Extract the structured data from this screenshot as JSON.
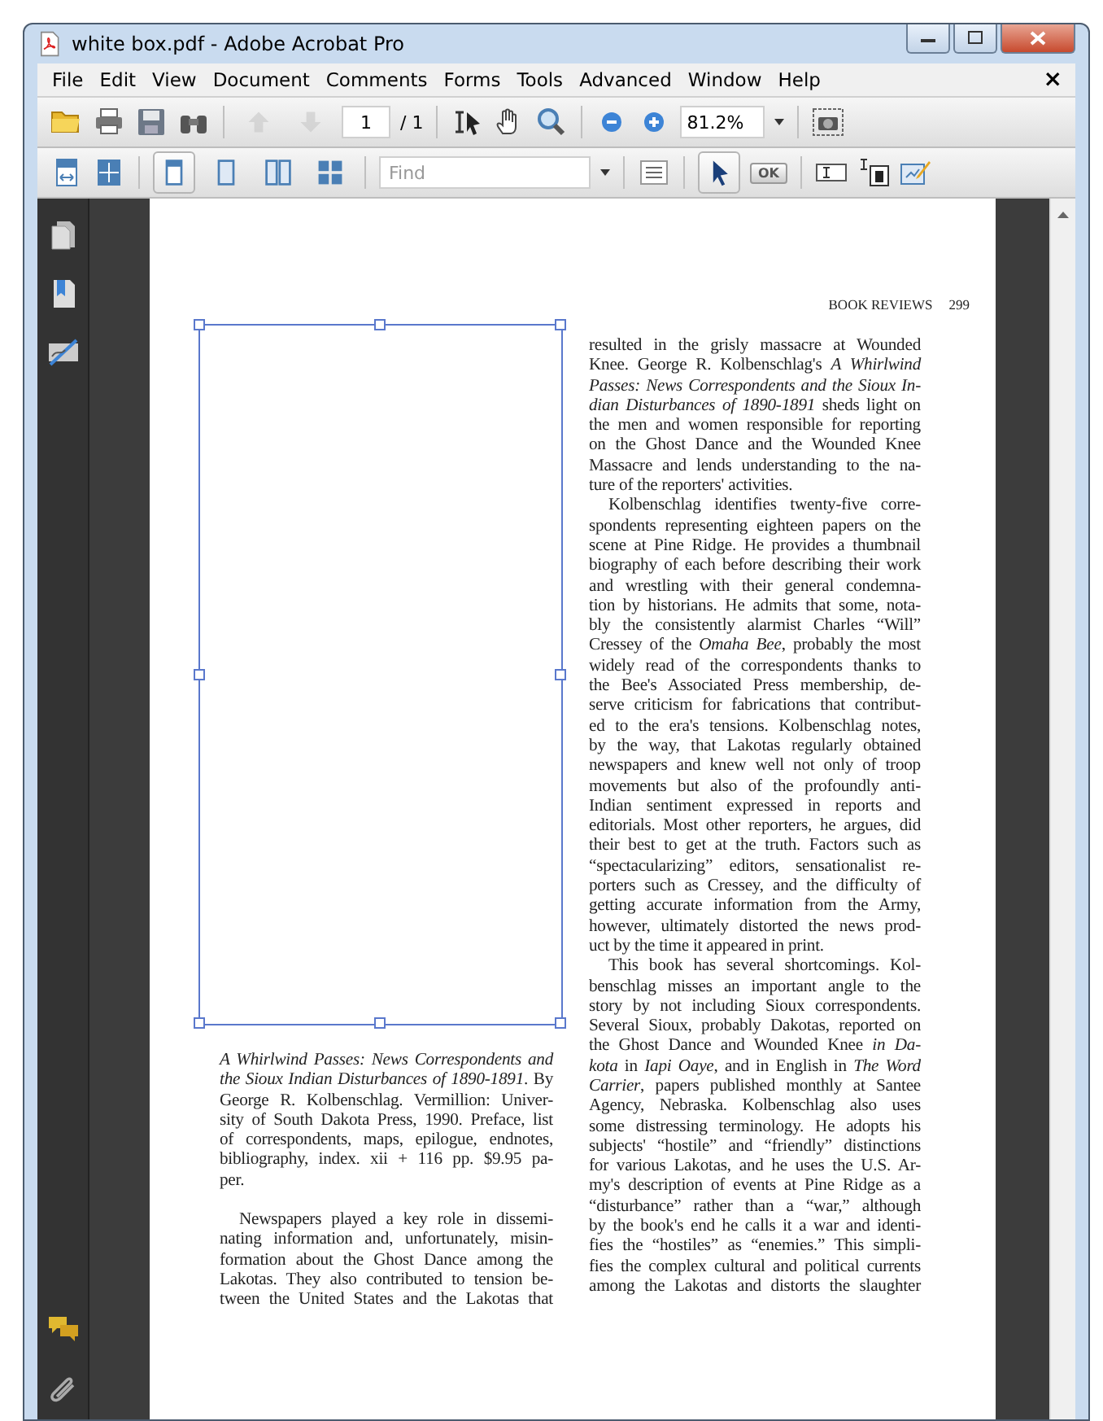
{
  "window": {
    "title": "white box.pdf - Adobe Acrobat Pro"
  },
  "menu": [
    "File",
    "Edit",
    "View",
    "Document",
    "Comments",
    "Forms",
    "Tools",
    "Advanced",
    "Window",
    "Help"
  ],
  "menu_close": "×",
  "toolbar": {
    "page_nav": [
      {
        "disabled": true
      },
      {
        "disabled": true
      }
    ],
    "page_field": {
      "value": "1"
    },
    "page_total": "/ 1",
    "zoom_field": {
      "value": "81.2%"
    }
  },
  "toolbar2": {
    "page_layouts": [
      {
        "selected": true
      },
      {
        "selected": false
      },
      {
        "selected": false
      },
      {
        "selected": false
      }
    ],
    "find": {
      "placeholder": "Find"
    },
    "select_tool": {
      "selected": true
    },
    "form_button": {
      "label": "OK"
    }
  },
  "page": {
    "running_head": "BOOK REVIEWS",
    "page_number": "299",
    "caption": [
      "*A Whirlwind Passes: News Correspondents and*",
      "*the Sioux Indian Disturbances of 1890-1891*. By",
      "George R. Kolbenschlag. Vermillion: Univer-",
      "sity of South Dakota Press, 1990. Preface, list",
      "of correspondents, maps, epilogue, endnotes,",
      "bibliography, index. xii + 116 pp. $9.95 pa-",
      "per."
    ],
    "left_paragraphs": [
      {
        "indent": true,
        "continued": true,
        "lines": [
          "Newspapers played a key role in dissemi-",
          "nating information and, unfortunately, misin-",
          "formation about the Ghost Dance among the",
          "Lakotas. They also contributed to tension be-",
          "tween the United States and the Lakotas that"
        ]
      }
    ],
    "right_paragraphs": [
      {
        "indent": false,
        "continued": false,
        "lines": [
          "resulted in the grisly massacre at Wounded",
          "Knee. George R. Kolbenschlag's *A Whirlwind*",
          "*Passes: News Correspondents and the Sioux In-*",
          "*dian Disturbances of 1890-1891* sheds light on",
          "the men and women responsible for reporting",
          "on the Ghost Dance and the Wounded Knee",
          "Massacre and lends understanding to the na-",
          "ture of the reporters' activities."
        ]
      },
      {
        "indent": true,
        "continued": false,
        "lines": [
          "Kolbenschlag identifies twenty-five corre-",
          "spondents representing eighteen papers on the",
          "scene at Pine Ridge. He provides a thumbnail",
          "biography of each before describing their work",
          "and wrestling with their general condemna-",
          "tion by historians. He admits that some, nota-",
          "bly the consistently alarmist Charles “Will”",
          "Cressey of the *Omaha Bee*, probably the most",
          "widely read of the correspondents thanks to",
          "the Bee's Associated Press membership, de-",
          "serve criticism for fabrications that contribut-",
          "ed to the era's tensions. Kolbenschlag notes,",
          "by the way, that Lakotas regularly obtained",
          "newspapers and knew well not only of troop",
          "movements but also of the profoundly anti-",
          "Indian sentiment expressed in reports and",
          "editorials. Most other reporters, he argues, did",
          "their best to get at the truth. Factors such as",
          "“spectacularizing” editors, sensationalist re-",
          "porters such as Cressey, and the difficulty of",
          "getting accurate information from the Army,",
          "however, ultimately distorted the news prod-",
          "uct by the time it appeared in print."
        ]
      },
      {
        "indent": true,
        "continued": true,
        "lines": [
          "This book has several shortcomings. Kol-",
          "benschlag misses an important angle to the",
          "story by not including Sioux correspondents.",
          "Several Sioux, probably Dakotas, reported on",
          "the Ghost Dance and Wounded Knee *in Da-*",
          "*kota* in *Iapi Oaye*, and in English in *The Word*",
          "*Carrier*, papers published monthly at Santee",
          "Agency, Nebraska. Kolbenschlag also uses",
          "some distressing terminology. He adopts his",
          "subjects' “hostile” and “friendly” distinctions",
          "for various Lakotas, and he uses the U.S. Ar-",
          "my's description of events at Pine Ridge as a",
          "“disturbance” rather than a “war,” although",
          "by the book's end he calls it a war and identi-",
          "fies the “hostiles” as “enemies.” This simpli-",
          "fies the complex cultural and political currents",
          "among the Lakotas and distorts the slaughter"
        ]
      }
    ]
  }
}
